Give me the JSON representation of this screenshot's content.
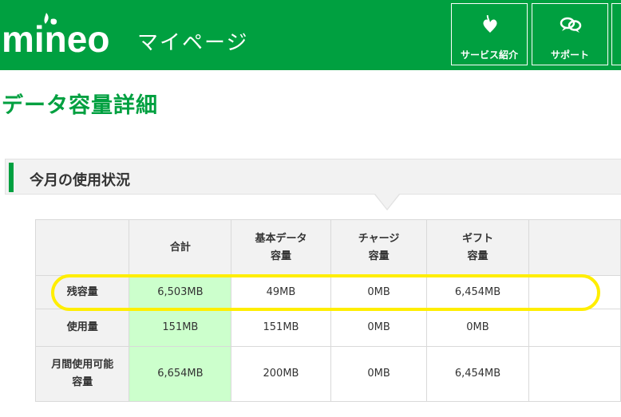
{
  "header": {
    "brand": "mineo",
    "brand_sub": "マイページ",
    "nav": [
      {
        "label": "サービス紹介",
        "icon": "heart-leaf-icon"
      },
      {
        "label": "サポート",
        "icon": "chat-bubbles-icon"
      }
    ]
  },
  "page": {
    "title": "データ容量詳細"
  },
  "section": {
    "title": "今月の使用状況"
  },
  "table": {
    "columns": [
      {
        "line1": "合計",
        "line2": ""
      },
      {
        "line1": "基本データ",
        "line2": "容量"
      },
      {
        "line1": "チャージ",
        "line2": "容量"
      },
      {
        "line1": "ギフト",
        "line2": "容量"
      }
    ],
    "rows": [
      {
        "label1": "残容量",
        "label2": "",
        "values": [
          "6,503MB",
          "49MB",
          "0MB",
          "6,454MB"
        ]
      },
      {
        "label1": "使用量",
        "label2": "",
        "values": [
          "151MB",
          "151MB",
          "0MB",
          "0MB"
        ]
      },
      {
        "label1": "月間使用可能",
        "label2": "容量",
        "values": [
          "6,654MB",
          "200MB",
          "0MB",
          "6,454MB"
        ]
      }
    ]
  },
  "colors": {
    "brand_green": "#00a040",
    "total_highlight": "#ccffcc",
    "annotation_yellow": "#ffee00"
  }
}
